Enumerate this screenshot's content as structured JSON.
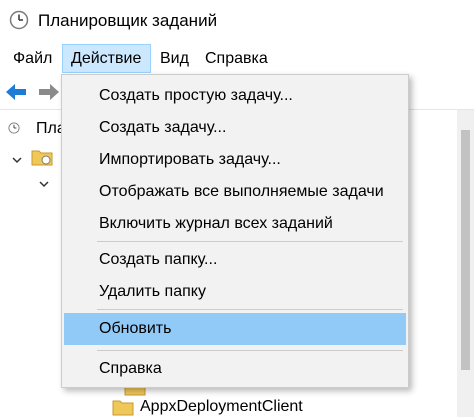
{
  "window": {
    "title": "Планировщик заданий"
  },
  "menubar": {
    "items": [
      "Файл",
      "Действие",
      "Вид",
      "Справка"
    ]
  },
  "tree": {
    "root_label": "Плани",
    "bottom_item_label": "AppxDeploymentClient"
  },
  "dropdown": {
    "items": [
      "Создать простую задачу...",
      "Создать задачу...",
      "Импортировать задачу...",
      "Отображать все выполняемые задачи",
      "Включить журнал всех заданий",
      "Создать папку...",
      "Удалить папку",
      "Обновить",
      "Справка"
    ],
    "highlighted": "Обновить"
  },
  "colors": {
    "menu_active_bg": "#cce8ff",
    "menu_active_border": "#99d1ff",
    "highlight_bg": "#91c9f7",
    "dropdown_bg": "#f2f2f2",
    "back_arrow": "#1e7bd6",
    "forward_arrow": "#8a8a8a"
  },
  "icons": {
    "app": "clock-icon",
    "back": "back-arrow-icon",
    "forward": "forward-arrow-icon",
    "folder": "folder-icon"
  }
}
